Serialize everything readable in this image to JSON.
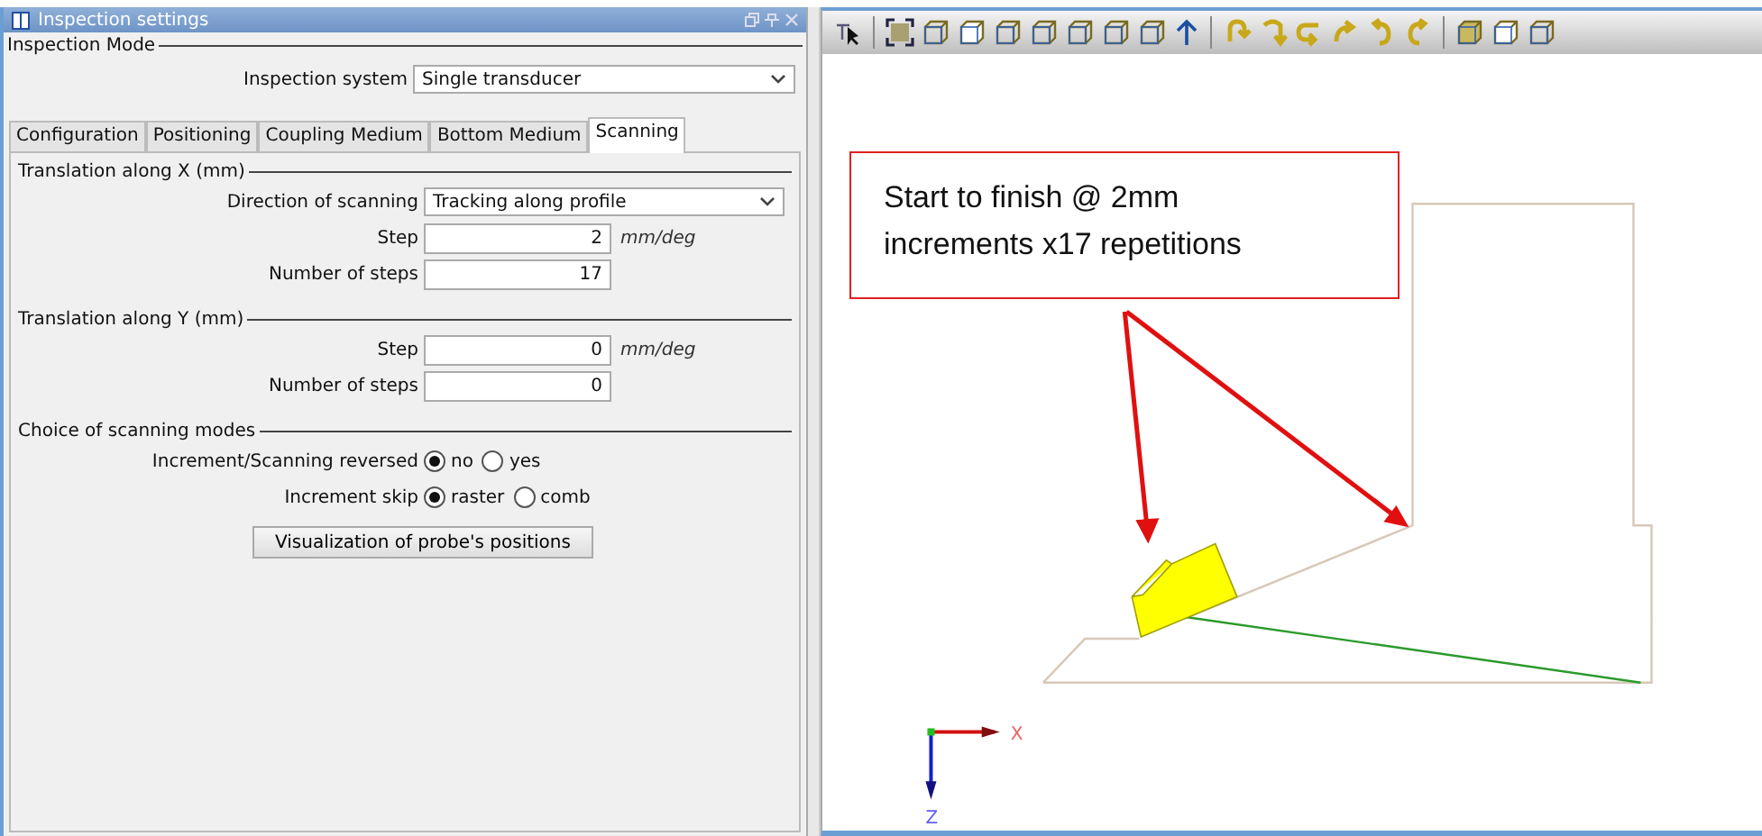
{
  "panel": {
    "title": "Inspection settings"
  },
  "inspection_mode": {
    "heading": "Inspection Mode",
    "label": "Inspection system",
    "value": "Single transducer"
  },
  "tabs": [
    {
      "label": "Configuration",
      "selected": false
    },
    {
      "label": "Positioning",
      "selected": false
    },
    {
      "label": "Coupling Medium",
      "selected": false
    },
    {
      "label": "Bottom Medium",
      "selected": false
    },
    {
      "label": "Scanning",
      "selected": true
    }
  ],
  "sections": [
    {
      "heading": "Translation along X (mm)",
      "rows": [
        {
          "kind": "select",
          "label": "Direction of scanning",
          "value": "Tracking along profile"
        },
        {
          "kind": "number",
          "label": "Step",
          "value": "2",
          "unit": "mm/deg"
        },
        {
          "kind": "number",
          "label": "Number of steps",
          "value": "17"
        }
      ]
    },
    {
      "heading": "Translation along Y (mm)",
      "rows": [
        {
          "kind": "number",
          "label": "Step",
          "value": "0",
          "unit": "mm/deg"
        },
        {
          "kind": "number",
          "label": "Number of steps",
          "value": "0"
        }
      ]
    },
    {
      "heading": "Choice of scanning modes",
      "rows": [
        {
          "kind": "radio",
          "label": "Increment/Scanning reversed",
          "options": [
            {
              "label": "no",
              "selected": true
            },
            {
              "label": "yes",
              "selected": false
            }
          ]
        },
        {
          "kind": "radio",
          "label": "Increment skip",
          "options": [
            {
              "label": "raster",
              "selected": true
            },
            {
              "label": "comb",
              "selected": false
            }
          ]
        },
        {
          "kind": "button",
          "label": "Visualization of probe's positions"
        }
      ]
    }
  ],
  "viewport": {
    "callout": {
      "lines": [
        "Start to finish @ 2mm",
        "increments x17 repetitions"
      ]
    },
    "axes": {
      "x": "X",
      "z": "Z"
    }
  }
}
